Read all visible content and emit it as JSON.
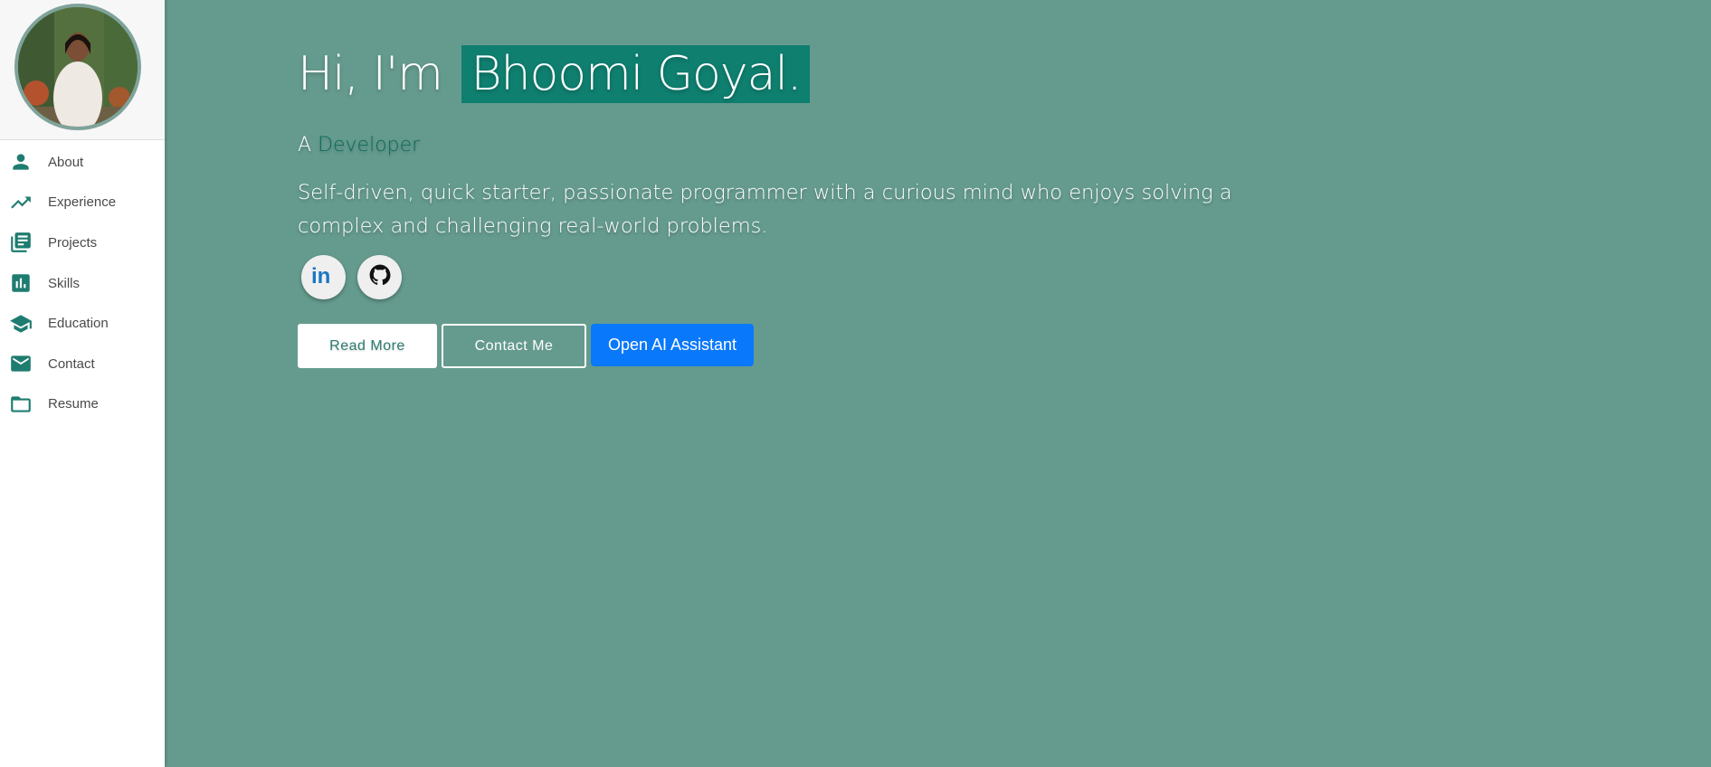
{
  "sidebar": {
    "items": [
      {
        "label": "About",
        "icon": "person-icon"
      },
      {
        "label": "Experience",
        "icon": "trending-up-icon"
      },
      {
        "label": "Projects",
        "icon": "library-books-icon"
      },
      {
        "label": "Skills",
        "icon": "bar-chart-icon"
      },
      {
        "label": "Education",
        "icon": "school-icon"
      },
      {
        "label": "Contact",
        "icon": "mail-icon"
      },
      {
        "label": "Resume",
        "icon": "folder-icon"
      }
    ]
  },
  "hero": {
    "greeting": "Hi, I'm",
    "name": "Bhoomi Goyal.",
    "role_prefix": "A",
    "role": "Developer",
    "bio": "Self-driven, quick starter, passionate programmer with a curious mind who enjoys solving a complex and challenging real-world problems."
  },
  "socials": [
    {
      "icon": "linkedin-icon"
    },
    {
      "icon": "github-icon"
    }
  ],
  "actions": {
    "read_more": "Read More",
    "contact_me": "Contact Me",
    "ai_assistant": "Open AI Assistant"
  },
  "colors": {
    "background": "#659b8e",
    "accent": "#0f7f6f",
    "ai_button": "#0a78fb"
  }
}
